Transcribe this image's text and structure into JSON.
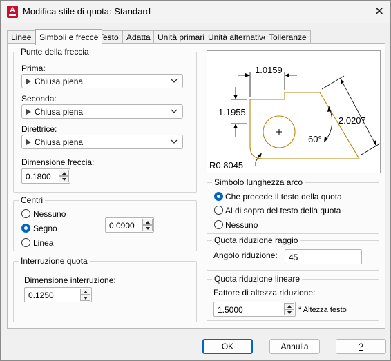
{
  "window": {
    "title": "Modifica stile di quota: Standard"
  },
  "tabs": [
    "Linee",
    "Simboli e frecce",
    "Testo",
    "Adatta",
    "Unità primarie",
    "Unità alternative",
    "Tolleranze"
  ],
  "arrowheads": {
    "title": "Punte della freccia",
    "first_label": "Prima:",
    "first_value": "Chiusa piena",
    "second_label": "Seconda:",
    "second_value": "Chiusa piena",
    "leader_label": "Direttrice:",
    "leader_value": "Chiusa piena",
    "size_label": "Dimensione freccia:",
    "size_value": "0.1800"
  },
  "center_marks": {
    "title": "Centri",
    "options": [
      "Nessuno",
      "Segno",
      "Linea"
    ],
    "selected": "Segno",
    "size_value": "0.0900"
  },
  "dim_break": {
    "title": "Interruzione quota",
    "size_label": "Dimensione interruzione:",
    "size_value": "0.1250"
  },
  "preview": {
    "dim_top": "1.0159",
    "dim_left": "1.1955",
    "dim_right": "2.0207",
    "angle": "60°",
    "radius": "R0.8045"
  },
  "arc_length": {
    "title": "Simbolo lunghezza arco",
    "options": [
      "Che precede il testo della quota",
      "Al di sopra del testo della quota",
      "Nessuno"
    ],
    "selected": "Che precede il testo della quota"
  },
  "radius_jog": {
    "title": "Quota riduzione raggio",
    "angle_label": "Angolo riduzione:",
    "angle_value": "45"
  },
  "linear_jog": {
    "title": "Quota riduzione lineare",
    "factor_label": "Fattore di altezza riduzione:",
    "factor_value": "1.5000",
    "suffix": "* Altezza testo"
  },
  "buttons": {
    "ok": "OK",
    "cancel": "Annulla",
    "help": "?"
  }
}
